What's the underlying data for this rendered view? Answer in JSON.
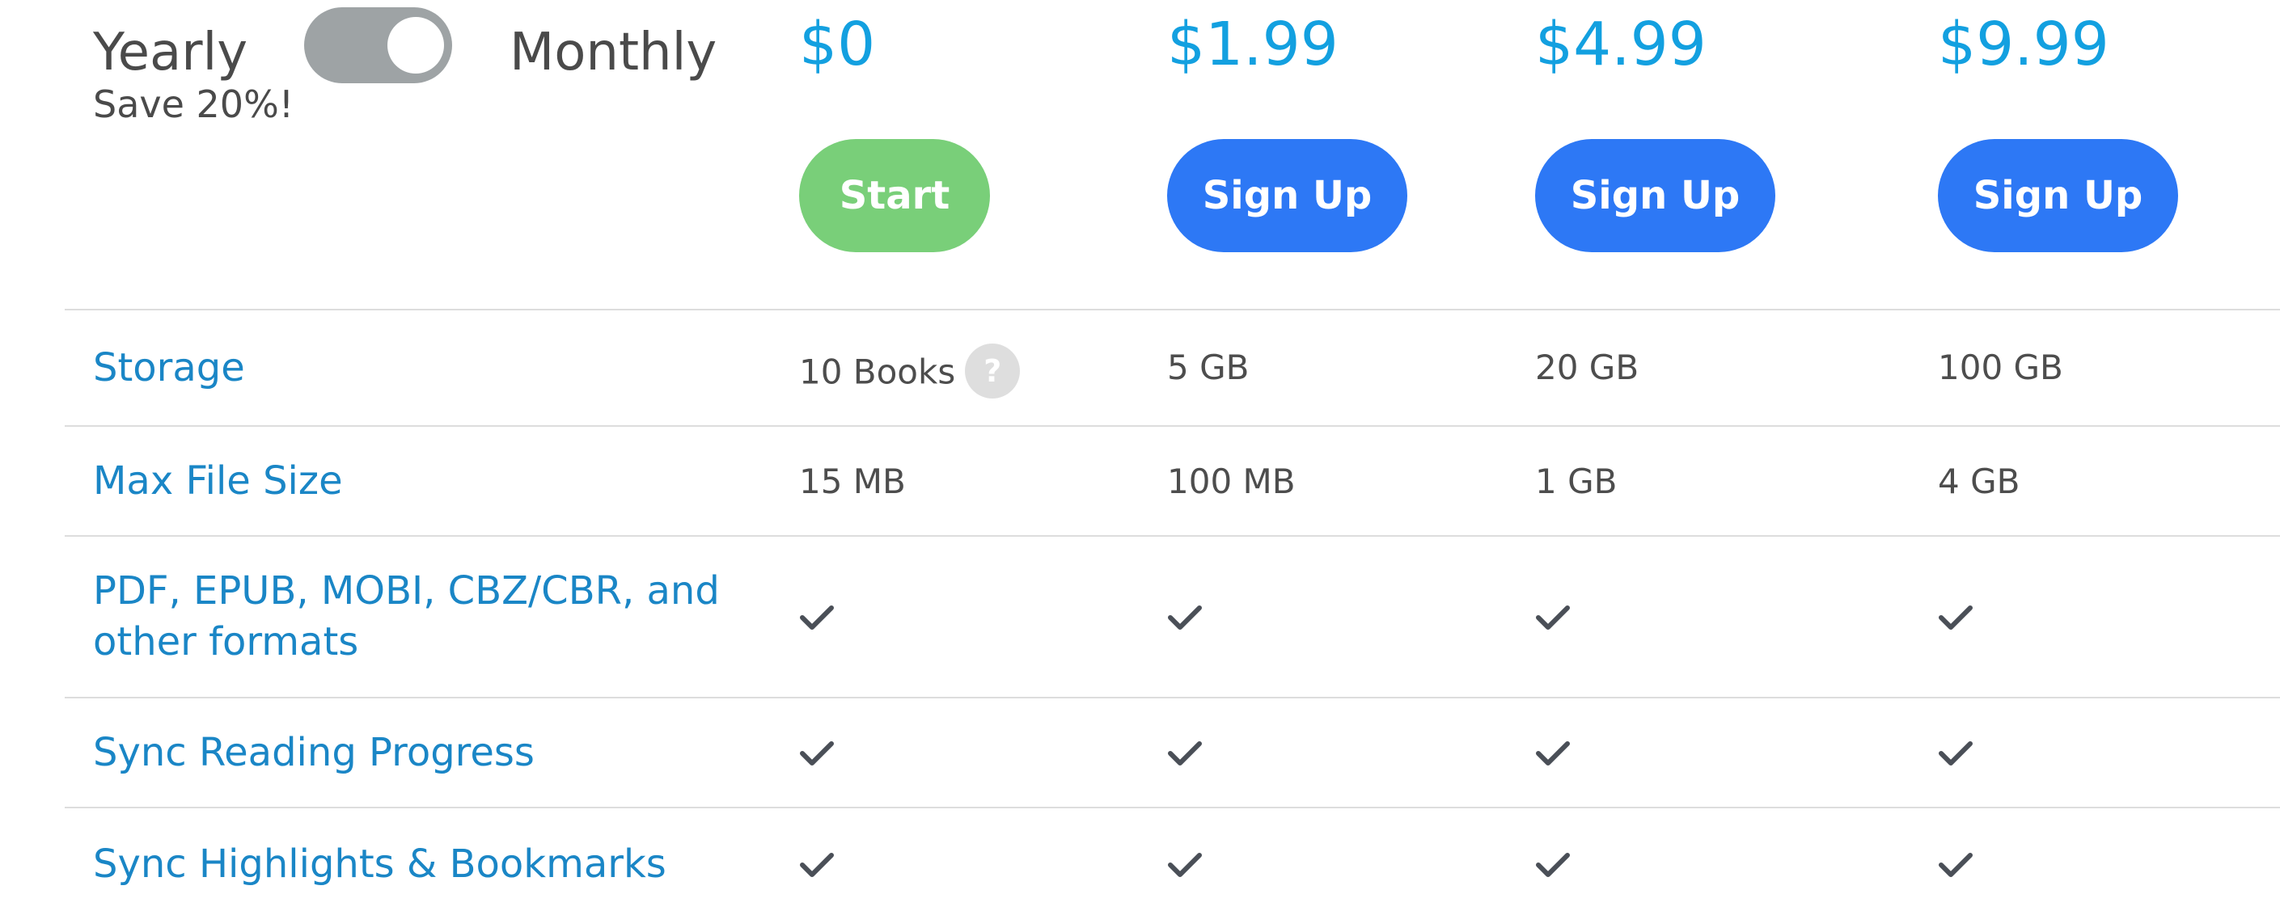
{
  "billing": {
    "yearly_label": "Yearly",
    "monthly_label": "Monthly",
    "save_text": "Save 20%!",
    "selected": "Monthly"
  },
  "plans": [
    {
      "price": "$0",
      "button": "Start"
    },
    {
      "price": "$1.99",
      "button": "Sign Up"
    },
    {
      "price": "$4.99",
      "button": "Sign Up"
    },
    {
      "price": "$9.99",
      "button": "Sign Up"
    }
  ],
  "features": [
    {
      "label": "Storage",
      "values": [
        "10 Books",
        "5 GB",
        "20 GB",
        "100 GB"
      ]
    },
    {
      "label": "Max File Size",
      "values": [
        "15 MB",
        "100 MB",
        "1 GB",
        "4 GB"
      ]
    },
    {
      "label": "PDF, EPUB, MOBI, CBZ/CBR, and other formats",
      "values": [
        "check-icon",
        "check-icon",
        "check-icon",
        "check-icon"
      ]
    },
    {
      "label": "Sync Reading Progress",
      "values": [
        "check-icon",
        "check-icon",
        "check-icon",
        "check-icon"
      ]
    },
    {
      "label": "Sync Highlights & Bookmarks",
      "values": [
        "check-icon",
        "check-icon",
        "check-icon",
        "check-icon"
      ]
    }
  ],
  "help_icon_glyph": "?",
  "colors": {
    "price": "#13a0e0",
    "start_button": "#79cf79",
    "signup_button": "#2d78f5",
    "feature_label": "#1a86c6",
    "toggle_track": "#9ea3a5"
  }
}
